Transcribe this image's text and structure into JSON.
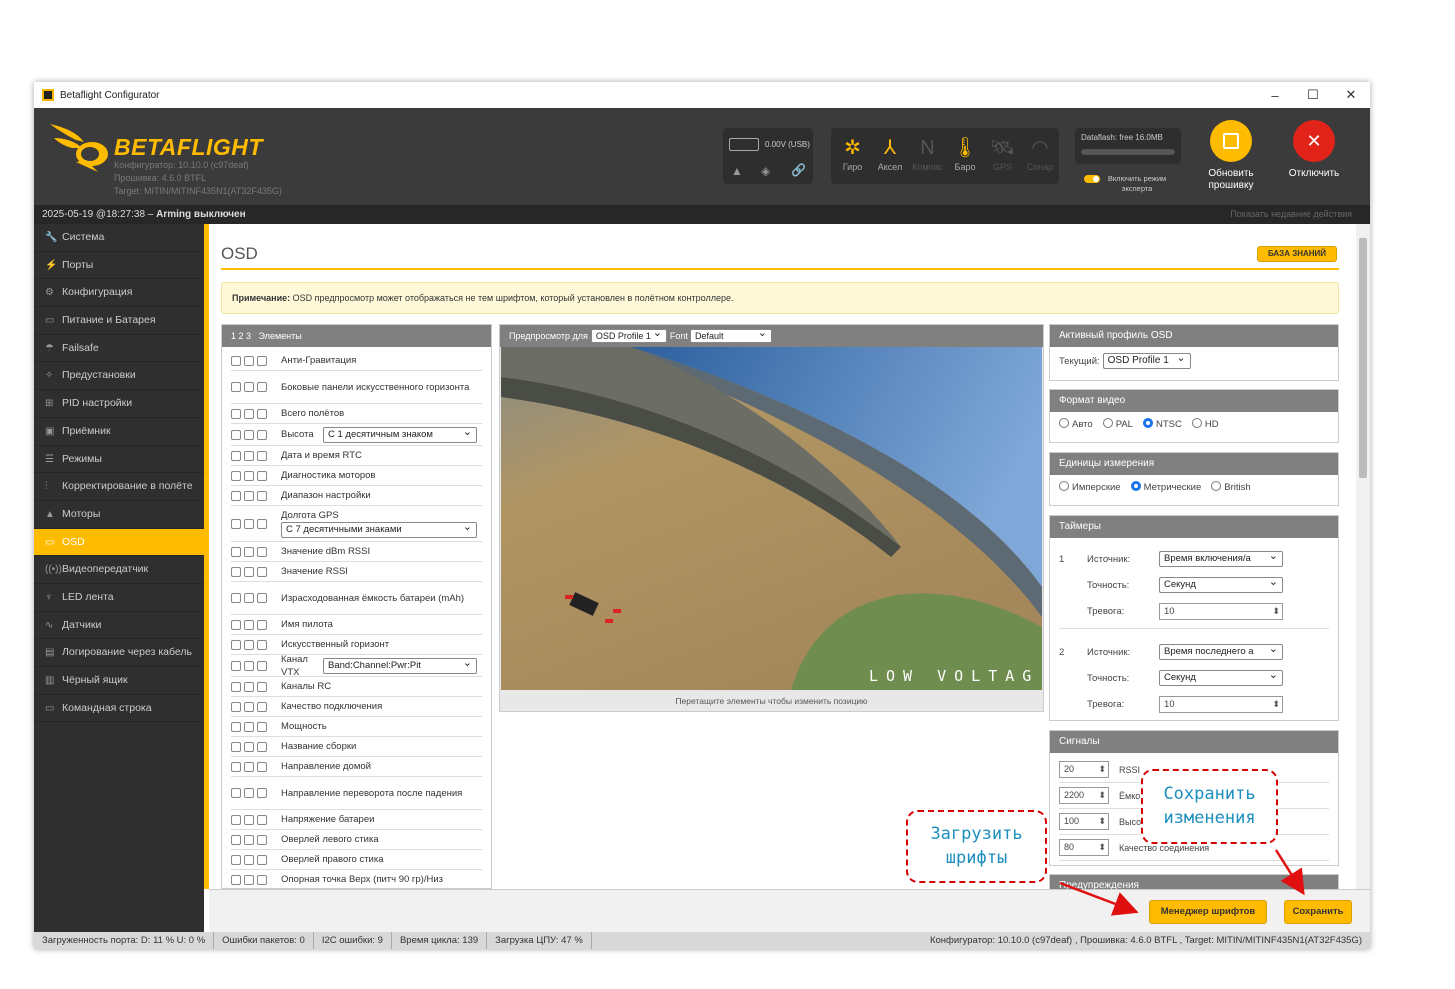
{
  "window": {
    "title": "Betaflight Configurator",
    "minimize": "–",
    "maximize": "☐",
    "close": "✕"
  },
  "header": {
    "brand": "BETAFLIGHT",
    "configurator": "Конфигуратор: 10.10.0 (c97deaf)",
    "firmware": "Прошивка: 4.6.0 BTFL",
    "target": "Target: MITIN/MITINF435N1(AT32F435G)",
    "battery": "0.00V (USB)",
    "dataflash": "Dataflash: free 16.0MB",
    "expert_mode": "Включить режим эксперта",
    "sensors": [
      {
        "label": "Гиро",
        "icon": "gyro-icon",
        "glyph": "✲",
        "active": true
      },
      {
        "label": "Аксел",
        "icon": "accel-icon",
        "glyph": "⅄",
        "active": true
      },
      {
        "label": "Компас",
        "icon": "compass-icon",
        "glyph": "N",
        "active": false
      },
      {
        "label": "Баро",
        "icon": "thermometer-icon",
        "glyph": "🌡",
        "active": true
      },
      {
        "label": "GPS",
        "icon": "satellite-icon",
        "glyph": "🛰",
        "active": false
      },
      {
        "label": "Сонар",
        "icon": "sonar-icon",
        "glyph": "◠",
        "active": false
      }
    ],
    "update_firmware": "Обновить прошивку",
    "disconnect": "Отключить"
  },
  "status": {
    "datetime": "2025-05-19 @18:27:38 – ",
    "arming": "Arming выключен",
    "recent": "Показать недавние действия"
  },
  "sidebar": {
    "items": [
      {
        "label": "Система",
        "icon": "wrench-icon",
        "glyph": "🔧"
      },
      {
        "label": "Порты",
        "icon": "plug-icon",
        "glyph": "⚡"
      },
      {
        "label": "Конфигурация",
        "icon": "gear-icon",
        "glyph": "⚙"
      },
      {
        "label": "Питание и Батарея",
        "icon": "battery-icon",
        "glyph": "▭"
      },
      {
        "label": "Failsafe",
        "icon": "parachute-icon",
        "glyph": "☂"
      },
      {
        "label": "Предустановки",
        "icon": "magic-icon",
        "glyph": "✧"
      },
      {
        "label": "PID настройки",
        "icon": "sitemap-icon",
        "glyph": "⊞"
      },
      {
        "label": "Приёмник",
        "icon": "receiver-icon",
        "glyph": "▣"
      },
      {
        "label": "Режимы",
        "icon": "modes-icon",
        "glyph": "☰"
      },
      {
        "label": "Корректирование в полёте",
        "icon": "sliders-icon",
        "glyph": "⫶"
      },
      {
        "label": "Моторы",
        "icon": "motor-icon",
        "glyph": "▲"
      },
      {
        "label": "OSD",
        "icon": "osd-icon",
        "glyph": "▭"
      },
      {
        "label": "Видеопередатчик",
        "icon": "vtx-icon",
        "glyph": "((•))"
      },
      {
        "label": "LED лента",
        "icon": "led-icon",
        "glyph": "♆"
      },
      {
        "label": "Датчики",
        "icon": "sensors-icon",
        "glyph": "∿"
      },
      {
        "label": "Логирование через кабель",
        "icon": "log-icon",
        "glyph": "▤"
      },
      {
        "label": "Чёрный ящик",
        "icon": "blackbox-icon",
        "glyph": "▥"
      },
      {
        "label": "Командная строка",
        "icon": "terminal-icon",
        "glyph": "▭"
      }
    ]
  },
  "page": {
    "title": "OSD",
    "knowledge": "БАЗА ЗНАНИЙ",
    "note_label": "Примечание:",
    "note_text": " OSD предпросмотр может отображаться не тем шрифтом, который установлен в полётном контроллере."
  },
  "elements": {
    "header_nums": "1   2   3",
    "header": "Элементы",
    "rows": [
      {
        "label": "Анти-Гравитация",
        "h": 20
      },
      {
        "label": "Боковые панели искусственного горизонта",
        "h": 33
      },
      {
        "label": "Всего полётов",
        "h": 20
      },
      {
        "label": "Высота",
        "select": "С 1 десятичным знаком",
        "h": 22
      },
      {
        "label": "Дата и время RTC",
        "h": 20
      },
      {
        "label": "Диагностика моторов",
        "h": 20
      },
      {
        "label": "Диапазон настройки",
        "h": 20
      },
      {
        "label": "Долгота GPS",
        "select": "С 7 десятичными знаками",
        "h": 36
      },
      {
        "label": "Значение dBm RSSI",
        "h": 20
      },
      {
        "label": "Значение RSSI",
        "h": 20
      },
      {
        "label": "Израсходованная ёмкость батареи (mAh)",
        "h": 33
      },
      {
        "label": "Имя пилота",
        "h": 20
      },
      {
        "label": "Искусственный горизонт",
        "h": 20
      },
      {
        "label": "Канал VTX",
        "select": "Band:Channel:Pwr:Pit",
        "h": 22
      },
      {
        "label": "Каналы RC",
        "h": 20
      },
      {
        "label": "Качество подключения",
        "h": 20
      },
      {
        "label": "Мощность",
        "h": 20
      },
      {
        "label": "Название сборки",
        "h": 20
      },
      {
        "label": "Направление домой",
        "h": 20
      },
      {
        "label": "Направление переворота после падения",
        "h": 33
      },
      {
        "label": "Напряжение батареи",
        "h": 20
      },
      {
        "label": "Оверлей левого стика",
        "h": 20
      },
      {
        "label": "Оверлей правого стика",
        "h": 20
      },
      {
        "label": "Опорная точка Верх (питч 90 гр)/Низ",
        "h": 20
      }
    ]
  },
  "preview": {
    "label": "Предпросмотр для",
    "profile": "OSD Profile 1",
    "font_label": "Font",
    "font": "Default",
    "overlay_text": "LOW VOLTAG",
    "caption": "Перетащите элементы чтобы изменить позицию"
  },
  "active_profile": {
    "title": "Активный профиль OSD",
    "current_label": "Текущий:",
    "current": "OSD Profile 1"
  },
  "video_format": {
    "title": "Формат видео",
    "options": [
      "Авто",
      "PAL",
      "NTSC",
      "HD"
    ],
    "selected": "NTSC"
  },
  "units": {
    "title": "Единицы измерения",
    "options": [
      "Имперские",
      "Метрические",
      "British"
    ],
    "selected": "Метрические"
  },
  "timers": {
    "title": "Таймеры",
    "source_label": "Источник:",
    "precision_label": "Точность:",
    "alarm_label": "Тревога:",
    "items": [
      {
        "n": "1",
        "source": "Время включения/а",
        "precision": "Секунд",
        "alarm": "10"
      },
      {
        "n": "2",
        "source": "Время последнего а",
        "precision": "Секунд",
        "alarm": "10"
      }
    ]
  },
  "alarms": {
    "title": "Сигналы",
    "rows": [
      {
        "value": "20",
        "label": "RSSI"
      },
      {
        "value": "2200",
        "label": "Ёмко"
      },
      {
        "value": "100",
        "label": "Высо"
      },
      {
        "value": "80",
        "label": "Качество соединения"
      }
    ],
    "next_title": "Предупреждения"
  },
  "buttons": {
    "font_manager": "Менеджер шрифтов",
    "save": "Сохранить"
  },
  "callouts": {
    "load_fonts": "Загрузить\nшрифты",
    "save_changes": "Сохранить\nизменения"
  },
  "footer": {
    "port_load": "Загруженность порта: D: 11 % U: 0 %",
    "packet_errors": "Ошибки пакетов: 0",
    "i2c_errors": "I2C ошибки: 9",
    "cycle_time": "Время цикла: 139",
    "cpu_load": "Загрузка ЦПУ: 47 %",
    "version": "Конфигуратор: 10.10.0 (c97deaf) , Прошивка: 4.6.0 BTFL , Target: MITIN/MITINF435N1(AT32F435G)"
  }
}
